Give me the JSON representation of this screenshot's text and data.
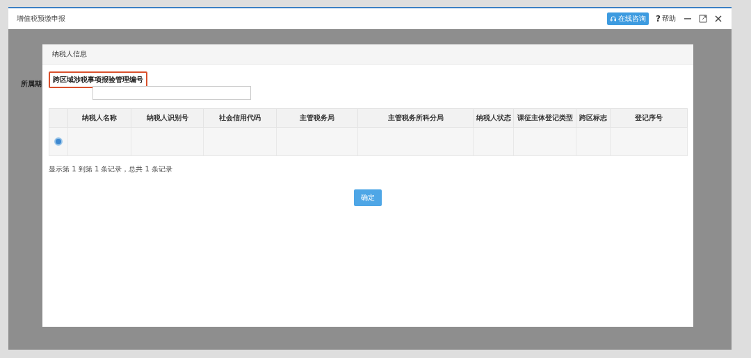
{
  "window": {
    "title": "增值税预缴申报",
    "consult_button": "在线咨询",
    "help_button": "帮助",
    "help_mark": "?"
  },
  "background": {
    "period_label": "所属期"
  },
  "modal": {
    "title": "纳税人信息",
    "field_label": "跨区域涉税事项报验管理编号",
    "table": {
      "columns": [
        "纳税人名称",
        "纳税人识别号",
        "社会信用代码",
        "主管税务局",
        "主管税务所科分局",
        "纳税人状态",
        "课征主体登记类型",
        "跨区标志",
        "登记序号"
      ],
      "rows": [
        {
          "selected": true
        }
      ]
    },
    "pagination": "显示第 1 到第 1 条记录，总共 1 条记录",
    "confirm_button": "确定"
  }
}
